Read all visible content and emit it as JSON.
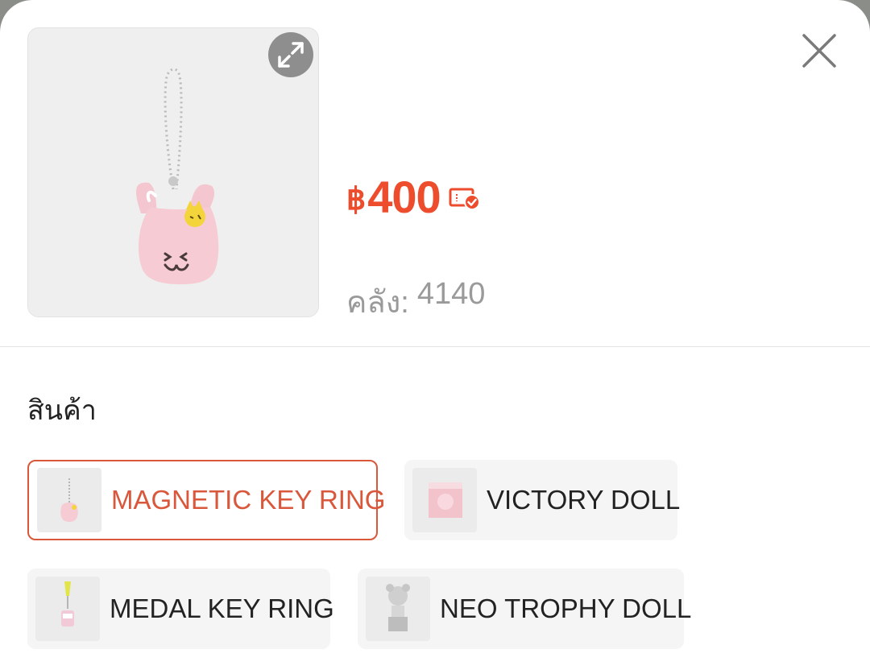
{
  "product": {
    "currency_symbol": "฿",
    "price": "400",
    "stock_label": "คลัง:",
    "stock_value": "4140",
    "image_icon": "bunny-keyring-image",
    "expand_icon": "expand-icon",
    "close_icon": "close-icon",
    "voucher_icon": "voucher-check-icon"
  },
  "variants": {
    "section_title": "สินค้า",
    "options": [
      {
        "label": "MAGNETIC KEY RING",
        "selected": true
      },
      {
        "label": "VICTORY DOLL",
        "selected": false
      },
      {
        "label": "MEDAL KEY RING",
        "selected": false
      },
      {
        "label": "NEO TROPHY DOLL",
        "selected": false
      }
    ]
  },
  "colors": {
    "accent": "#ee4d2d",
    "selected_border": "#d9573b",
    "overlay": "#8a8d88"
  }
}
